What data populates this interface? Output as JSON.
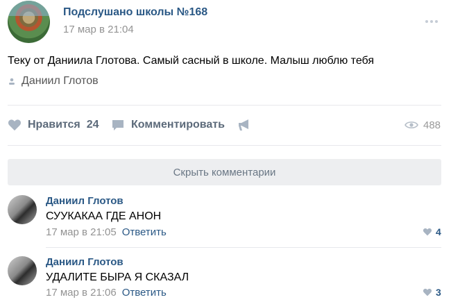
{
  "post": {
    "group_name": "Подслушано школы №168",
    "date": "17 мар в 21:04",
    "text": "Теку от Даниила Глотова. Самый сасный в школе. Малыш люблю тебя",
    "signer": "Даниил Глотов",
    "like_label": "Нравится",
    "like_count": "24",
    "comment_label": "Комментировать",
    "views": "488"
  },
  "hide_comments_label": "Скрыть комментарии",
  "comments": [
    {
      "author": "Даниил Глотов",
      "text": "СУУКАКАА ГДЕ АНОН",
      "date": "17 мар в 21:05",
      "reply_label": "Ответить",
      "likes": "4"
    },
    {
      "author": "Даниил Глотов",
      "text": "УДАЛИТЕ БЫРА Я СКАЗАЛ",
      "date": "17 мар в 21:06",
      "reply_label": "Ответить",
      "likes": "3"
    }
  ],
  "icons": {
    "more": "more-dots-icon",
    "user": "user-icon",
    "like": "heart-icon",
    "comment": "comment-icon",
    "share": "megaphone-icon",
    "views": "eye-icon"
  },
  "colors": {
    "link": "#2a5885",
    "muted": "#939393",
    "action": "#5c6a7a",
    "button_bg": "#edeef0"
  }
}
